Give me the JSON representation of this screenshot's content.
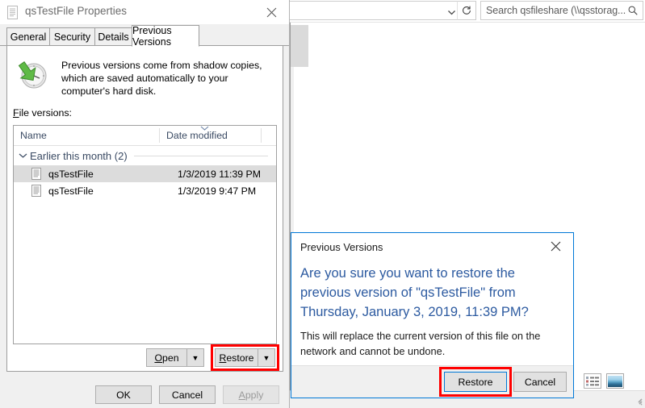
{
  "explorer": {
    "address_bar": {
      "value": "",
      "chevron_icon": "chevron-down-icon"
    },
    "refresh_icon": "refresh-icon",
    "search": {
      "text": "Search qsfileshare (\\\\qsstorag...",
      "icon": "search-icon"
    },
    "view_buttons": [
      {
        "name": "details-view-button",
        "icon": "details-view-icon"
      },
      {
        "name": "large-icons-view-button",
        "icon": "large-icons-view-icon"
      }
    ]
  },
  "properties": {
    "title": "qsTestFile Properties",
    "title_icon": "document-icon",
    "close_label": "✕",
    "tabs": [
      {
        "label": "General",
        "selected": false
      },
      {
        "label": "Security",
        "selected": false
      },
      {
        "label": "Details",
        "selected": false
      },
      {
        "label": "Previous Versions",
        "selected": true
      }
    ],
    "intro_text": "Previous versions come from shadow copies, which are saved automatically to your computer's hard disk.",
    "intro_icon": "clock-restore-icon",
    "file_versions_label_prefix": "F",
    "file_versions_label_rest": "ile versions:",
    "list": {
      "columns": [
        "Name",
        "Date modified"
      ],
      "sort_chevron_icon": "chevron-up-icon",
      "group": {
        "label": "Earlier this month (2)",
        "chevron_icon": "chevron-down-icon"
      },
      "rows": [
        {
          "icon": "document-icon",
          "name": "qsTestFile",
          "date": "1/3/2019 11:39 PM",
          "selected": true
        },
        {
          "icon": "document-icon",
          "name": "qsTestFile",
          "date": "1/3/2019 9:47 PM",
          "selected": false
        }
      ]
    },
    "open_button": {
      "prefix": "",
      "accel": "O",
      "rest": "pen",
      "arrow": "▼"
    },
    "restore_button": {
      "accel": "R",
      "rest": "estore",
      "arrow": "▼",
      "highlighted": true
    },
    "ok_button": "OK",
    "cancel_button": "Cancel",
    "apply_button": {
      "accel": "A",
      "rest": "pply",
      "disabled": true
    }
  },
  "confirm_dialog": {
    "title": "Previous Versions",
    "close_label": "✕",
    "headline": "Are you sure you want to restore the previous version of \"qsTestFile\" from Thursday, January 3, 2019, 11:39 PM?",
    "body": "This will replace the current version of this file on the network and cannot be undone.",
    "restore_button": "Restore",
    "cancel_button": "Cancel",
    "restore_highlighted": true
  },
  "colors": {
    "accent_blue": "#0078d7",
    "headline_blue": "#2c5aa0",
    "highlight_red": "#ff0000",
    "selection_grey": "#dcdcdc",
    "dialog_grey": "#f0f0f0"
  }
}
